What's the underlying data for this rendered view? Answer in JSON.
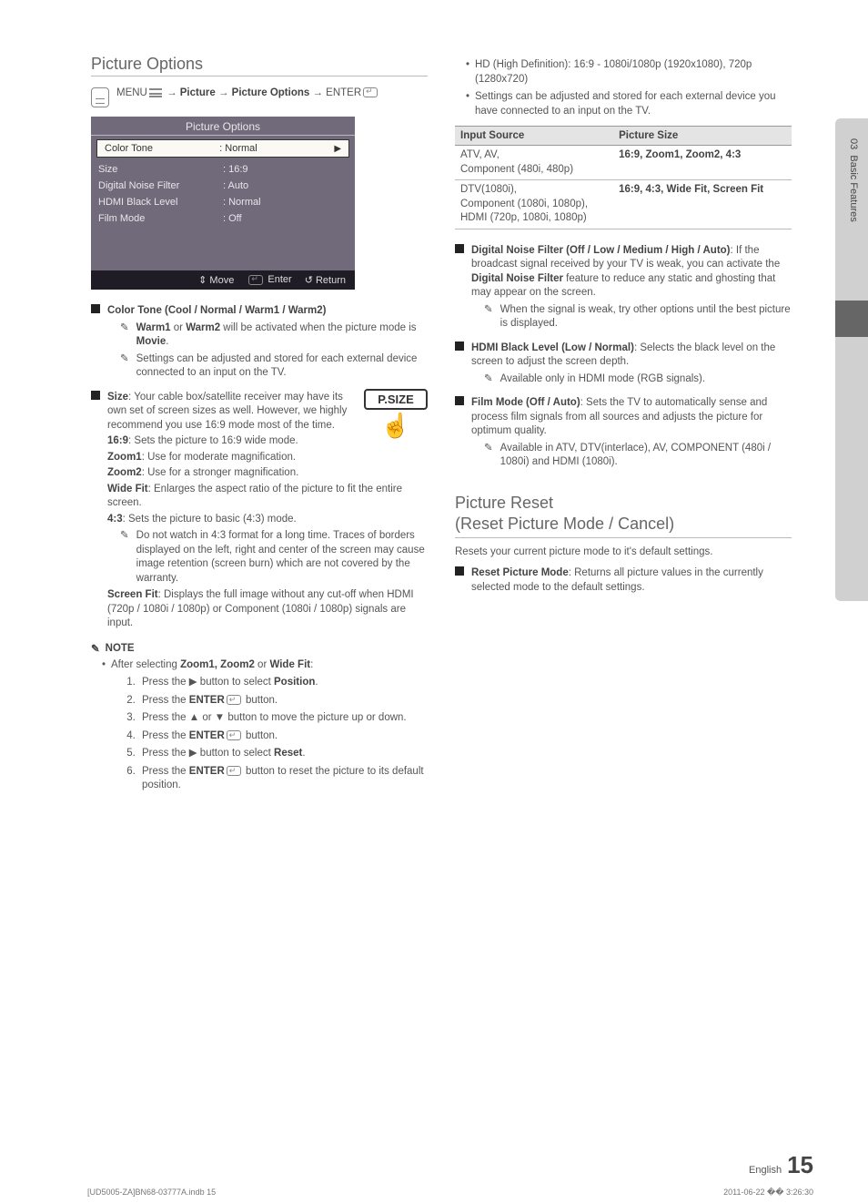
{
  "sideTab": {
    "chapter": "03",
    "name": "Basic Features"
  },
  "left": {
    "title": "Picture Options",
    "menuPath": {
      "prefix": "MENU",
      "parts": [
        "Picture",
        "Picture Options"
      ],
      "suffix": "ENTER"
    },
    "osd": {
      "title": "Picture Options",
      "rows": [
        {
          "label": "Color Tone",
          "value": ": Normal",
          "selected": true,
          "arrow": "▶"
        },
        {
          "label": "Size",
          "value": ": 16:9"
        },
        {
          "label": "Digital Noise Filter",
          "value": ": Auto"
        },
        {
          "label": "HDMI Black Level",
          "value": ": Normal"
        },
        {
          "label": "Film Mode",
          "value": ": Off"
        }
      ],
      "footer": {
        "move": "Move",
        "enter": "Enter",
        "return": "Return",
        "moveIcon": "⇕",
        "enterIcon": "↵",
        "returnIcon": "↺"
      }
    },
    "colorTone": {
      "heading": "Color Tone (Cool / Normal / Warm1 / Warm2)",
      "notes": [
        {
          "bold1": "Warm1",
          "mid": " or ",
          "bold2": "Warm2",
          "rest": " will be activated when the picture mode is ",
          "bold3": "Movie",
          "tail": "."
        },
        {
          "text": "Settings can be adjusted and stored for each external device connected to an input on the TV."
        }
      ]
    },
    "size": {
      "leadBold": "Size",
      "leadText": ": Your cable box/satellite receiver may have its own set of screen sizes as well. However, we highly recommend you use 16:9 mode most of the time.",
      "psizeLabel": "P.SIZE",
      "items": [
        {
          "name": "16:9",
          "desc": ": Sets the picture to 16:9 wide mode."
        },
        {
          "name": "Zoom1",
          "desc": ": Use for moderate magnification."
        },
        {
          "name": "Zoom2",
          "desc": ": Use for a stronger magnification."
        },
        {
          "name": "Wide Fit",
          "desc": ": Enlarges the aspect ratio of the picture to fit the entire screen."
        },
        {
          "name": "4:3",
          "desc": ": Sets the picture to basic (4:3) mode."
        }
      ],
      "caution": "Do not watch in 4:3 format for a long time. Traces of borders displayed on the left, right and center of the screen may cause image retention (screen burn) which are not covered by the warranty.",
      "screenFit": {
        "name": "Screen Fit",
        "desc": ": Displays the full image without any cut-off when HDMI (720p / 1080i / 1080p) or Component (1080i / 1080p) signals are input."
      }
    },
    "noteBlock": {
      "heading": "NOTE",
      "lead": {
        "pre": "After selecting ",
        "b": "Zoom1, Zoom2",
        "mid": " or ",
        "b2": "Wide Fit",
        "post": ":"
      },
      "steps": [
        {
          "pre": "Press the ▶ button to select ",
          "b": "Position",
          "post": "."
        },
        {
          "pre": "Press the ",
          "b": "ENTER",
          "post": " button."
        },
        {
          "pre": "Press the ▲ or ▼ button to move the picture up or down."
        },
        {
          "pre": "Press the ",
          "b": "ENTER",
          "post": " button."
        },
        {
          "pre": "Press the ▶ button to select ",
          "b": "Reset",
          "post": "."
        },
        {
          "pre": "Press the ",
          "b": "ENTER",
          "post": " button to reset the picture to its default position."
        }
      ]
    }
  },
  "right": {
    "topBullets": [
      "HD (High Definition): 16:9 - 1080i/1080p (1920x1080), 720p (1280x720)",
      "Settings can be adjusted and stored for each external device you have connected to an input on the TV."
    ],
    "table": {
      "headers": [
        "Input Source",
        "Picture Size"
      ],
      "rows": [
        {
          "src": "ATV, AV,\nComponent (480i, 480p)",
          "size": "16:9, Zoom1, Zoom2, 4:3"
        },
        {
          "src": "DTV(1080i),\nComponent (1080i, 1080p),\nHDMI (720p, 1080i, 1080p)",
          "size": "16:9, 4:3, Wide Fit, Screen Fit"
        }
      ]
    },
    "dnf": {
      "heading": "Digital Noise Filter (Off / Low / Medium / High / Auto)",
      "text1": ": If the broadcast signal received by your TV is weak, you can activate the ",
      "bold": "Digital Noise Filter",
      "text2": " feature to reduce any static and ghosting that may appear on the screen.",
      "note": "When the signal is weak, try other options until the best picture is displayed."
    },
    "hdmi": {
      "heading": "HDMI Black Level (Low / Normal)",
      "text": ": Selects the black level on the screen to adjust the screen depth.",
      "note": "Available only in HDMI mode (RGB signals)."
    },
    "film": {
      "heading": "Film Mode (Off / Auto)",
      "text": ": Sets the TV to automatically sense and process film signals from all sources and adjusts the picture for optimum quality.",
      "note": "Available in ATV, DTV(interlace), AV, COMPONENT (480i / 1080i) and HDMI (1080i)."
    },
    "reset": {
      "title1": "Picture Reset",
      "title2": "(Reset Picture Mode / Cancel)",
      "lead": "Resets your current picture mode to it's default settings.",
      "item": {
        "b": "Reset Picture Mode",
        "text": ": Returns all picture values in the currently selected mode to the default settings."
      }
    }
  },
  "footer": {
    "lang": "English",
    "page": "15"
  },
  "printmark": {
    "left": "[UD5005-ZA]BN68-03777A.indb   15",
    "right": "2011-06-22   �� 3:26:30"
  }
}
